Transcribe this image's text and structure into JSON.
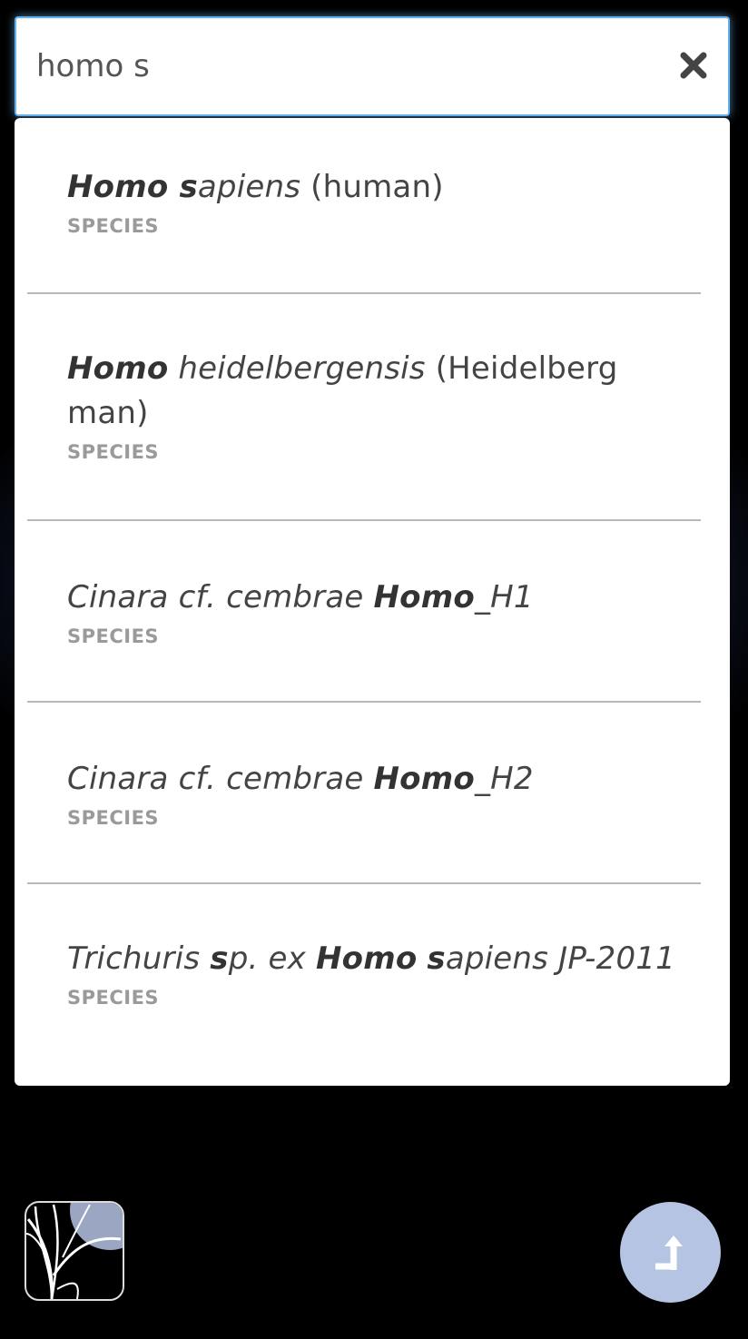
{
  "search": {
    "value": "homo s",
    "clear_icon": "close-icon"
  },
  "results": [
    {
      "parts": [
        {
          "text": "Homo ",
          "style": "bold-italic"
        },
        {
          "text": "s",
          "style": "bold-italic"
        },
        {
          "text": "apiens",
          "style": "italic"
        },
        {
          "text": " (human)",
          "style": "normal"
        }
      ],
      "type": "SPECIES"
    },
    {
      "parts": [
        {
          "text": "Homo",
          "style": "bold-italic"
        },
        {
          "text": " heidelbergensis",
          "style": "italic"
        },
        {
          "text": " (Heidelberg man)",
          "style": "normal"
        }
      ],
      "type": "SPECIES"
    },
    {
      "parts": [
        {
          "text": "Cinara cf. cembrae ",
          "style": "italic"
        },
        {
          "text": "Homo",
          "style": "bold-italic"
        },
        {
          "text": "_H1",
          "style": "italic"
        }
      ],
      "type": "SPECIES"
    },
    {
      "parts": [
        {
          "text": "Cinara cf. cembrae ",
          "style": "italic"
        },
        {
          "text": "Homo",
          "style": "bold-italic"
        },
        {
          "text": "_H2",
          "style": "italic"
        }
      ],
      "type": "SPECIES"
    },
    {
      "parts": [
        {
          "text": "Trichuris ",
          "style": "italic"
        },
        {
          "text": "s",
          "style": "bold-italic"
        },
        {
          "text": "p. ex ",
          "style": "italic"
        },
        {
          "text": "Homo",
          "style": "bold-italic"
        },
        {
          "text": " ",
          "style": "italic"
        },
        {
          "text": "s",
          "style": "bold-italic"
        },
        {
          "text": "apiens JP-2011",
          "style": "italic"
        }
      ],
      "type": "SPECIES"
    }
  ],
  "footer": {
    "logo_icon": "tree-logo-icon",
    "share_icon": "share-arrow-icon",
    "share_color": "#b4c4e2"
  },
  "colors": {
    "focus_border": "#66afe9",
    "type_label": "#9a9a9a"
  }
}
